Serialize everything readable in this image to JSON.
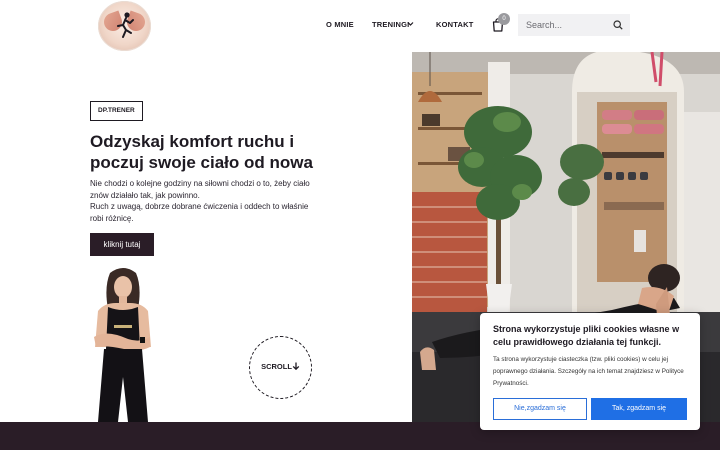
{
  "header": {
    "nav": {
      "about": "O MNIE",
      "trainings": "TRENINGI",
      "contact": "KONTAKT"
    },
    "cart": {
      "count": "0",
      "icon": "cart-icon"
    },
    "search": {
      "placeholder": "Search...",
      "value": "",
      "icon": "search-icon"
    }
  },
  "hero": {
    "badge": "DP.TRENER",
    "title": "Odzyskaj komfort ruchu i poczuj swoje ciało od nowa",
    "description": [
      "Nie chodzi o kolejne godziny na siłowni chodzi o to, żeby ciało znów działało tak, jak powinno.",
      "Ruch z uwagą, dobrze dobrane ćwiczenia i oddech to właśnie robi różnicę."
    ],
    "cta_label": "kliknij tutaj",
    "scroll_label": "SCROLL"
  },
  "cookie": {
    "title": "Strona wykorzystuje pliki cookies własne w celu prawidłowego działania tej funkcji.",
    "text": "Ta strona wykorzystuje ciasteczka (tzw. pliki cookies) w celu jej poprawnego działania. Szczegóły na ich temat znajdziesz w Polityce Prywatności.",
    "reject_label": "Nie,zgadzam się",
    "accept_label": "Tak, zgadzam się"
  },
  "colors": {
    "brand_dark": "#2a1d27",
    "accept_blue": "#1f6fe5",
    "text": "#1e1a22"
  }
}
